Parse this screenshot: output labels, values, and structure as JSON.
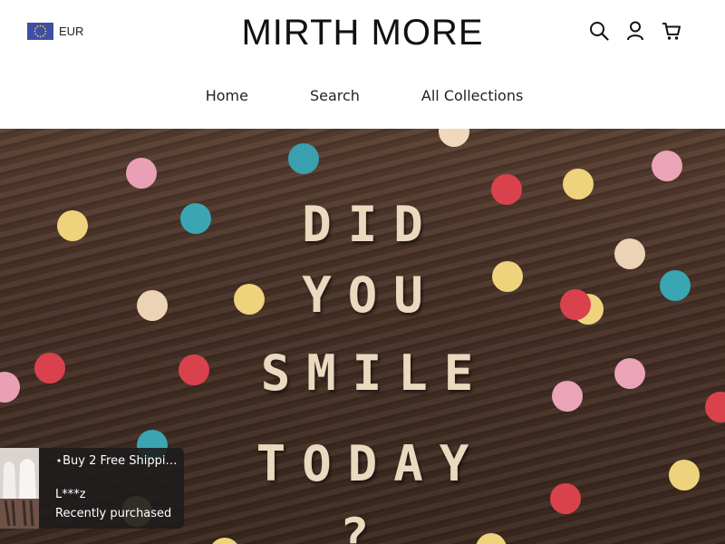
{
  "header": {
    "currency": {
      "code": "EUR",
      "flag_icon": "eu-flag-icon"
    },
    "logo": "MIRTH MORE",
    "icons": [
      "search-icon",
      "account-icon",
      "cart-icon"
    ]
  },
  "nav": {
    "items": [
      {
        "label": "Home"
      },
      {
        "label": "Search"
      },
      {
        "label": "All Collections"
      }
    ]
  },
  "hero": {
    "lines": [
      "DID",
      "YOU",
      "SMILE",
      "TODAY",
      "?"
    ]
  },
  "popup": {
    "title": "⋆Buy 2 Free Shippin...",
    "customer": "L***z",
    "status": "Recently purchased"
  }
}
